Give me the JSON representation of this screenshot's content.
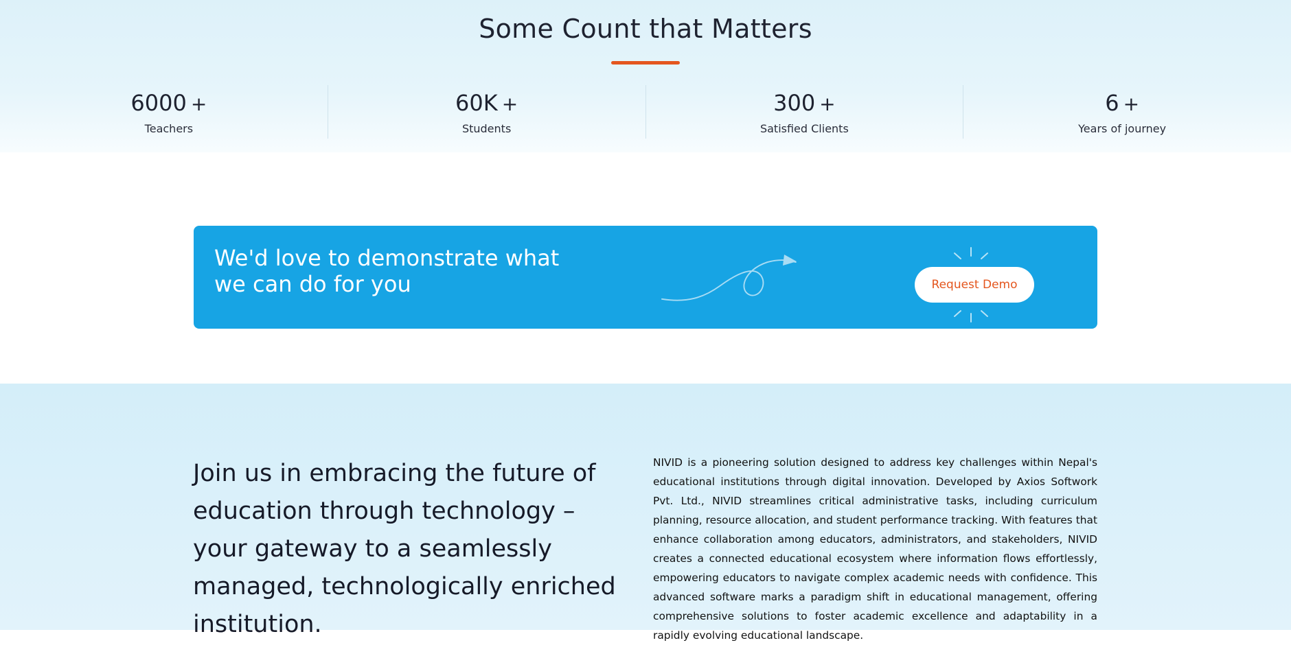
{
  "stats": {
    "title": "Some Count that Matters",
    "items": [
      {
        "number": "6000",
        "suffix": "+",
        "label": "Teachers"
      },
      {
        "number": "60K",
        "suffix": "+",
        "label": "Students"
      },
      {
        "number": "300",
        "suffix": "+",
        "label": "Satisfied Clients"
      },
      {
        "number": "6",
        "suffix": "+",
        "label": "Years of journey"
      }
    ]
  },
  "demo": {
    "heading": "We'd love to demonstrate what we can do for you",
    "button_label": "Request Demo"
  },
  "join": {
    "heading": "Join us in embracing the future of education through technology – your gateway to a seamlessly managed, technologically enriched institution.",
    "paragraph": "NIVID is a pioneering solution designed to address key challenges within Nepal's educational institutions through digital innovation. Developed by Axios Softwork Pvt. Ltd., NIVID streamlines critical administrative tasks, including curriculum planning, resource allocation, and student performance tracking. With features that enhance collaboration among educators, administrators, and stakeholders, NIVID creates a connected educational ecosystem where information flows effortlessly, empowering educators to navigate complex academic needs with confidence. This advanced software marks a paradigm shift in educational management, offering comprehensive solutions to foster academic excellence and adaptability in a rapidly evolving educational landscape."
  },
  "colors": {
    "accent": "#e4561e",
    "banner": "#17a4e4"
  },
  "icons": {
    "arrow": "curly-arrow-icon",
    "sparkle": "sparkle-icon"
  }
}
